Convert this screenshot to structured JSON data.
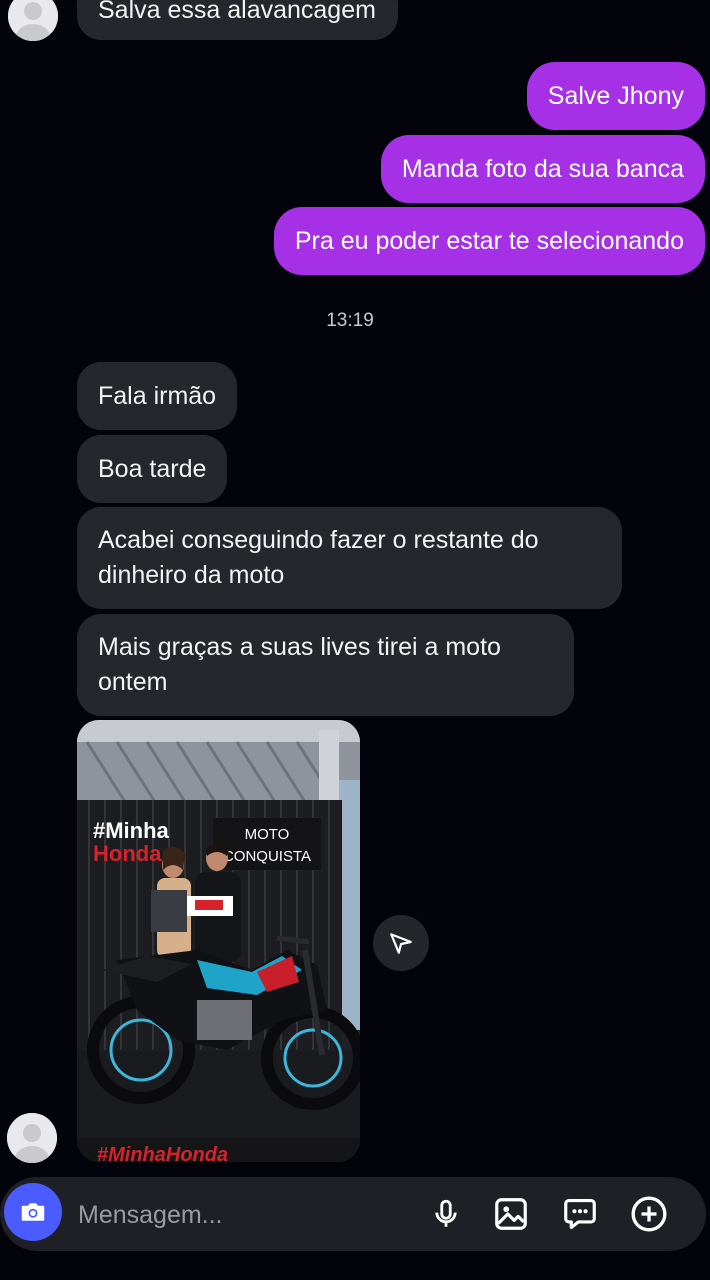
{
  "messages": [
    {
      "id": "m0",
      "direction": "in",
      "text": "Salva essa alavancagem"
    },
    {
      "id": "m1",
      "direction": "out",
      "text": "Salve Jhony"
    },
    {
      "id": "m2",
      "direction": "out",
      "text": "Manda foto da sua banca"
    },
    {
      "id": "m3",
      "direction": "out",
      "text": "Pra eu poder estar te selecionando"
    },
    {
      "id": "m4",
      "direction": "in",
      "text": "Fala irmão"
    },
    {
      "id": "m5",
      "direction": "in",
      "text": "Boa tarde"
    },
    {
      "id": "m6",
      "direction": "in",
      "text": "Acabei conseguindo fazer o restante do dinheiro da moto"
    },
    {
      "id": "m7",
      "direction": "in",
      "text": "Mais graças a suas lives tirei a moto ontem"
    }
  ],
  "timestamp": "13:19",
  "photo": {
    "sign_line1": "#Minha",
    "sign_line2": "Honda",
    "plaque_line1": "MOTO",
    "plaque_line2": "CONQUISTA",
    "banner": "#MinhaHonda"
  },
  "composer": {
    "placeholder": "Mensagem..."
  },
  "icons": {
    "camera": "camera-icon",
    "mic": "microphone-icon",
    "gallery": "gallery-icon",
    "sticker": "chat-sticker-icon",
    "plus": "plus-circle-icon",
    "share": "send-icon"
  },
  "colors": {
    "background": "#03040b",
    "incoming_bubble": "#26272d",
    "outgoing_bubble": "#a530e6",
    "camera_button": "#4a5bff"
  }
}
